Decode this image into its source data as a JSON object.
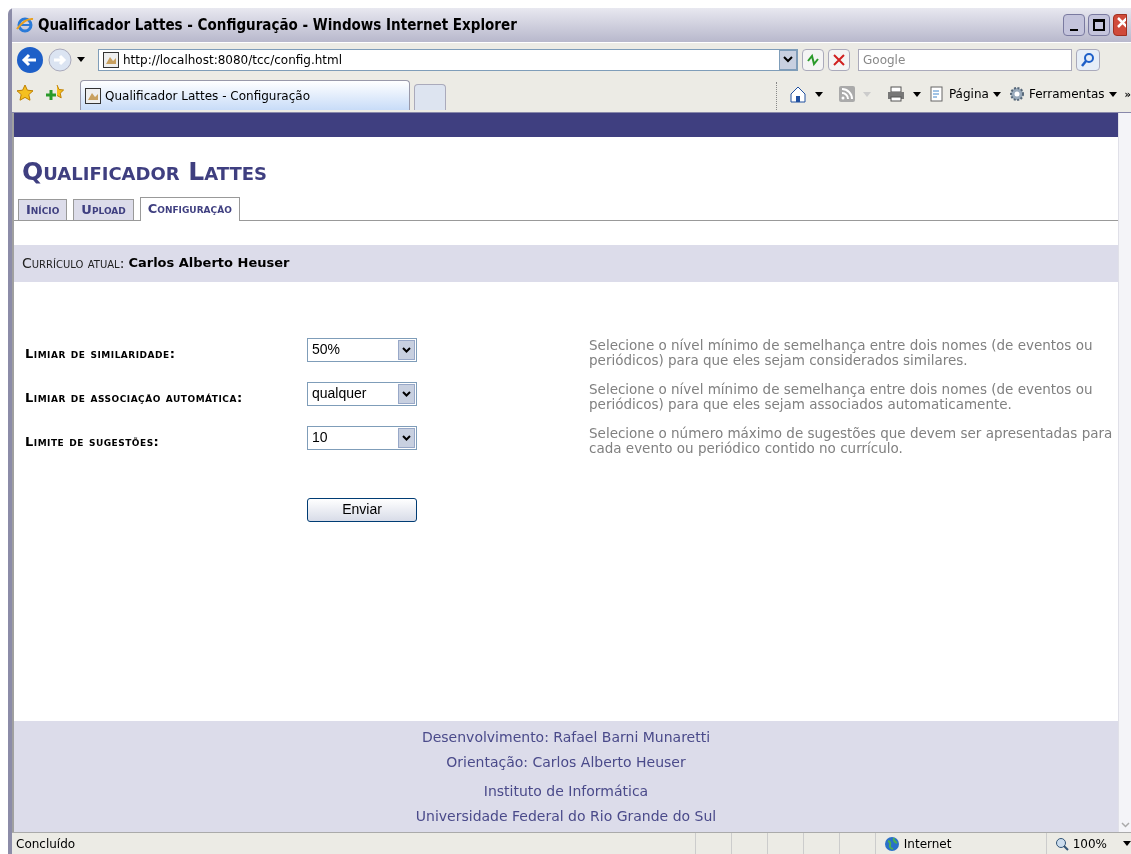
{
  "window": {
    "title": "Qualificador Lattes - Configuração - Windows Internet Explorer"
  },
  "address_bar": {
    "url": "http://localhost:8080/tcc/config.html"
  },
  "search": {
    "placeholder": "Google"
  },
  "browser_tabs": [
    {
      "label": "Qualificador Lattes - Configuração",
      "selected": true
    }
  ],
  "command_bar": {
    "items": [
      "Página",
      "Ferramentas"
    ],
    "overflow": "»"
  },
  "page": {
    "brand": "Qualificador Lattes",
    "tabs": [
      {
        "label": "Início",
        "selected": false
      },
      {
        "label": "Upload",
        "selected": false
      },
      {
        "label": "Configuração",
        "selected": true
      }
    ],
    "current": {
      "label": "Currículo atual:",
      "value": "Carlos Alberto Heuser"
    },
    "settings": [
      {
        "label": "Limiar de similaridade:",
        "value": "50%",
        "description": "Selecione o nível mínimo de semelhança entre dois nomes (de eventos ou periódicos) para que eles sejam considerados similares."
      },
      {
        "label": "Limiar de associação automática:",
        "value": "qualquer",
        "description": "Selecione o nível mínimo de semelhança entre dois nomes (de eventos ou periódicos) para que eles sejam associados automaticamente."
      },
      {
        "label": "Limite de sugestões:",
        "value": "10",
        "description": "Selecione o número máximo de sugestões que devem ser apresentadas para cada evento ou periódico contido no currículo."
      }
    ],
    "submit": "Enviar",
    "footer": [
      [
        "Desenvolvimento: Rafael Barni Munaretti",
        "Orientação: Carlos Alberto Heuser"
      ],
      [
        "Instituto de Informática",
        "Universidade Federal do Rio Grande do Sul"
      ]
    ]
  },
  "status_bar": {
    "text": "Concluído",
    "zone": "Internet",
    "zoom": "100%"
  }
}
